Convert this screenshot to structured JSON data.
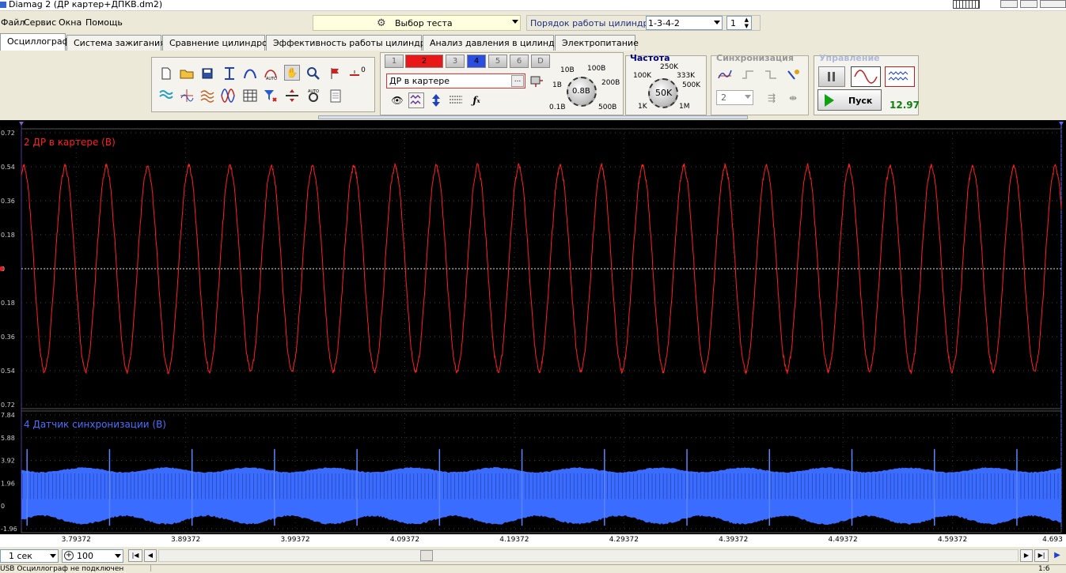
{
  "window": {
    "title": "Diamag 2 (ДР картер+ДПКВ.dm2)"
  },
  "menu": [
    "Файл",
    "Сервис",
    "Окна",
    "Помощь"
  ],
  "test_select": {
    "label": "Выбор теста"
  },
  "cyl_order": {
    "label": "Порядок работы цилиндров",
    "value": "1-3-4-2",
    "count": "1"
  },
  "tabs": [
    "Осциллограф",
    "Система зажигания",
    "Сравнение цилиндров",
    "Эффективность работы цилиндров",
    "Анализ давления в цилиндре",
    "Электропитание"
  ],
  "active_tab": "Осциллограф",
  "channels": {
    "buttons": [
      "1",
      "2",
      "3",
      "4",
      "5",
      "6",
      "D"
    ],
    "active": "2",
    "active_color": "#e81818",
    "secondary": "4",
    "secondary_color": "#2a4fe0",
    "name": "ДР в картере"
  },
  "voltage_knob": {
    "value": "0.8В",
    "marks": [
      "10В",
      "100В",
      "1В",
      "200В",
      "0.1В",
      "500В"
    ]
  },
  "frequency": {
    "label": "Частота",
    "value": "50K",
    "marks": [
      "250K",
      "100K",
      "333K",
      "500K",
      "1K",
      "1M"
    ]
  },
  "sync": {
    "label": "Синхронизация",
    "value": "2"
  },
  "control": {
    "label": "Управление",
    "start": "Пуск",
    "voltage": "12.97"
  },
  "top_icon_misc": "0",
  "plot1": {
    "title": "2 ДР в картере (В)",
    "color": "#ff2020",
    "yticks": [
      "0.72",
      "0.54",
      "0.36",
      "0.18",
      "0",
      "0.18",
      "0.36",
      "0.54",
      "0.72"
    ]
  },
  "plot2": {
    "title": "4 Датчик синхронизации (В)",
    "color": "#3a6cff",
    "yticks": [
      "7.84",
      "5.88",
      "3.92",
      "1.96",
      "0",
      "-1.96"
    ]
  },
  "xaxis": {
    "ticks": [
      "3.79372",
      "3.89372",
      "3.99372",
      "4.09372",
      "4.19372",
      "4.29372",
      "4.39372",
      "4.49372",
      "4.59372",
      "4.693"
    ]
  },
  "bottom": {
    "time": "1 сек",
    "zoom": "100"
  },
  "status": {
    "text": "USB Осциллограф не подключен",
    "right": "1:6"
  },
  "chart_data": [
    {
      "type": "line",
      "title": "2 ДР в картере (В)",
      "ylim": [
        -0.72,
        0.72
      ],
      "xlim": [
        3.74372,
        4.693
      ],
      "series": [
        {
          "name": "2 ДР в картере (В)",
          "amplitude": 0.54,
          "period_s": 0.03766
        }
      ]
    },
    {
      "type": "line",
      "title": "4 Датчик синхронизации (В)",
      "ylim": [
        -1.96,
        7.84
      ],
      "xlim": [
        3.74372,
        4.693
      ],
      "series": [
        {
          "name": "4 Датчик синхронизации (В)",
          "band": [
            -1.2,
            3.1
          ],
          "spike_level": 4.9,
          "spike_period_s": 0.0753
        }
      ]
    }
  ]
}
